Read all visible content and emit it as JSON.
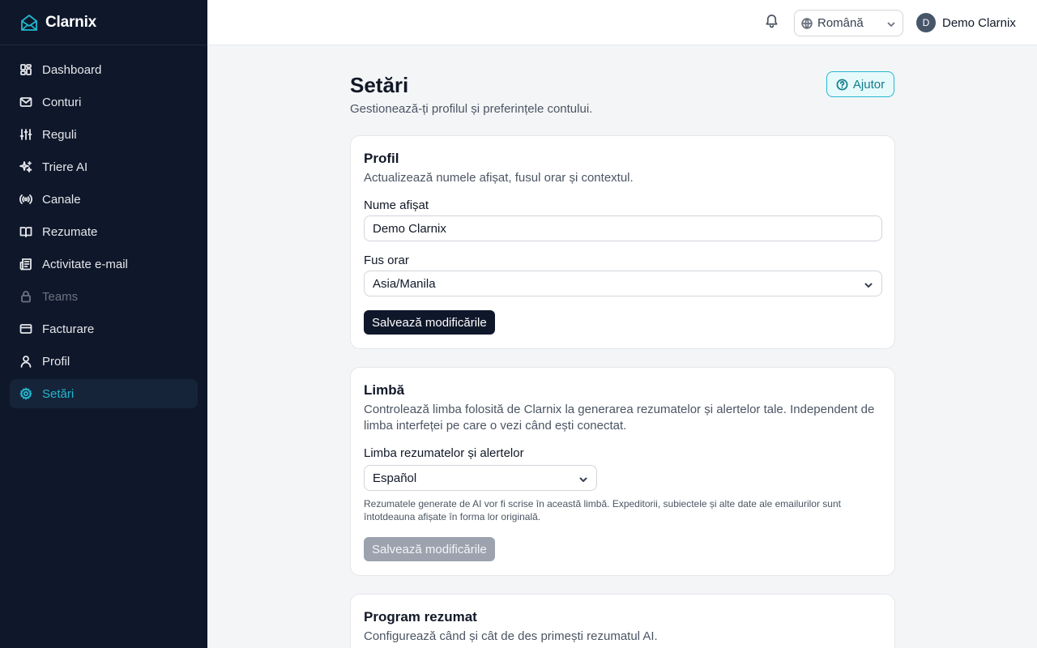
{
  "brand": {
    "name": "Clarnix"
  },
  "sidebar": {
    "items": [
      {
        "label": "Dashboard",
        "icon": "dashboard-icon"
      },
      {
        "label": "Conturi",
        "icon": "mail-icon"
      },
      {
        "label": "Reguli",
        "icon": "sliders-icon"
      },
      {
        "label": "Triere AI",
        "icon": "sparkles-icon"
      },
      {
        "label": "Canale",
        "icon": "radio-icon"
      },
      {
        "label": "Rezumate",
        "icon": "book-open-icon"
      },
      {
        "label": "Activitate e-mail",
        "icon": "newspaper-icon"
      },
      {
        "label": "Teams",
        "icon": "lock-icon",
        "disabled": true
      },
      {
        "label": "Facturare",
        "icon": "credit-card-icon"
      },
      {
        "label": "Profil",
        "icon": "user-icon"
      },
      {
        "label": "Setări",
        "icon": "gear-icon",
        "active": true
      }
    ]
  },
  "topbar": {
    "language": "Română",
    "user_initial": "D",
    "user_name": "Demo Clarnix"
  },
  "page": {
    "title": "Setări",
    "subtitle": "Gestionează-ți profilul și preferințele contului.",
    "help_label": "Ajutor"
  },
  "profile_card": {
    "title": "Profil",
    "description": "Actualizează numele afișat, fusul orar și contextul.",
    "display_name_label": "Nume afișat",
    "display_name_value": "Demo Clarnix",
    "timezone_label": "Fus orar",
    "timezone_value": "Asia/Manila",
    "save_label": "Salvează modificările"
  },
  "language_card": {
    "title": "Limbă",
    "description": "Controlează limba folosită de Clarnix la generarea rezumatelor și alertelor tale. Independent de limba interfeței pe care o vezi când ești conectat.",
    "field_label": "Limba rezumatelor și alertelor",
    "field_value": "Español",
    "hint": "Rezumatele generate de AI vor fi scrise în această limbă. Expeditorii, subiectele și alte date ale emailurilor sunt întotdeauna afișate în forma lor originală.",
    "save_label": "Salvează modificările"
  },
  "schedule_card": {
    "title": "Program rezumat",
    "description": "Configurează când și cât de des primești rezumatul AI."
  },
  "colors": {
    "sidebar_bg": "#0f172a",
    "accent": "#22b8cf",
    "primary_button": "#0f172a",
    "disabled_button": "#9ca3af"
  }
}
